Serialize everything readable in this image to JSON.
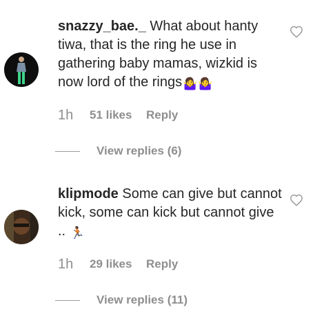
{
  "comments": [
    {
      "username": "snazzy_bae._",
      "text": "What about hanty tiwa, that is the ring he use in gathering baby mamas, wizkid is now lord of the rings",
      "emojis": [
        "🤷‍♀️",
        "🤷‍♀️"
      ],
      "time": "1h",
      "likes": "51 likes",
      "reply_label": "Reply",
      "view_replies": "View replies (6)"
    },
    {
      "username": "klipmode",
      "text": "Some can give but cannot kick, some can kick but cannot give ..",
      "emojis": [
        "🏃🏾"
      ],
      "time": "1h",
      "likes": "29 likes",
      "reply_label": "Reply",
      "view_replies": "View replies (11)"
    }
  ],
  "icons": {
    "like": "heart-outline-icon"
  },
  "colors": {
    "text": "#262626",
    "muted": "#8e8e8e",
    "background": "#ffffff"
  }
}
